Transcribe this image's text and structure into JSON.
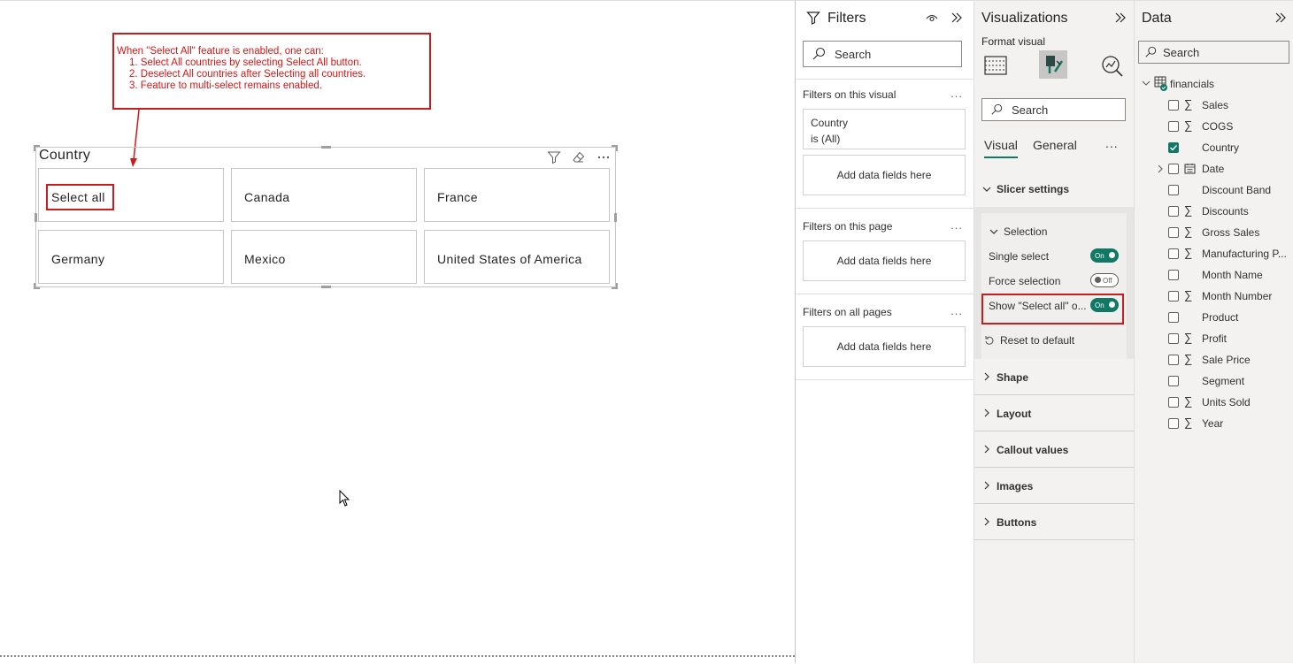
{
  "canvas": {
    "annotation": {
      "intro": "When \"Select All\" feature is enabled, one can:",
      "items": [
        "1. Select All countries by selecting Select All button.",
        "2. Deselect All countries after Selecting all countries.",
        "3. Feature to multi-select remains enabled."
      ]
    },
    "slicer": {
      "title": "Country",
      "tiles": [
        "Select all",
        "Canada",
        "France",
        "Germany",
        "Mexico",
        "United States of America"
      ]
    }
  },
  "filters": {
    "title": "Filters",
    "search_placeholder": "Search",
    "on_visual": "Filters on this visual",
    "country_card": {
      "field": "Country",
      "value": "is (All)"
    },
    "add_fields": "Add data fields here",
    "on_page": "Filters on this page",
    "on_all_pages": "Filters on all pages",
    "more": "..."
  },
  "visualizations": {
    "title": "Visualizations",
    "format_visual": "Format visual",
    "search_placeholder": "Search",
    "tabs": [
      "Visual",
      "General"
    ],
    "more": "...",
    "slicer_settings": "Slicer settings",
    "selection": "Selection",
    "rows": [
      {
        "label": "Single select",
        "state": "On"
      },
      {
        "label": "Force selection",
        "state": "Off"
      },
      {
        "label": "Show \"Select all\" o...",
        "state": "On"
      }
    ],
    "reset": "Reset to default",
    "sections": [
      "Shape",
      "Layout",
      "Callout values",
      "Images",
      "Buttons"
    ]
  },
  "data": {
    "title": "Data",
    "search_placeholder": "Search",
    "table": "financials",
    "fields": [
      {
        "name": "Sales",
        "sigma": true,
        "checked": false
      },
      {
        "name": "COGS",
        "sigma": true,
        "checked": false
      },
      {
        "name": "Country",
        "sigma": false,
        "checked": true
      },
      {
        "name": "Date",
        "sigma": false,
        "checked": false,
        "calendar": true,
        "expandable": true
      },
      {
        "name": "Discount Band",
        "sigma": false,
        "checked": false
      },
      {
        "name": "Discounts",
        "sigma": true,
        "checked": false
      },
      {
        "name": "Gross Sales",
        "sigma": true,
        "checked": false
      },
      {
        "name": "Manufacturing P...",
        "sigma": true,
        "checked": false
      },
      {
        "name": "Month Name",
        "sigma": false,
        "checked": false
      },
      {
        "name": "Month Number",
        "sigma": true,
        "checked": false
      },
      {
        "name": "Product",
        "sigma": false,
        "checked": false
      },
      {
        "name": "Profit",
        "sigma": true,
        "checked": false
      },
      {
        "name": "Sale Price",
        "sigma": true,
        "checked": false
      },
      {
        "name": "Segment",
        "sigma": false,
        "checked": false
      },
      {
        "name": "Units Sold",
        "sigma": true,
        "checked": false
      },
      {
        "name": "Year",
        "sigma": true,
        "checked": false
      }
    ]
  },
  "colors": {
    "accent": "#117865",
    "annotation_red": "#c81d1d"
  }
}
